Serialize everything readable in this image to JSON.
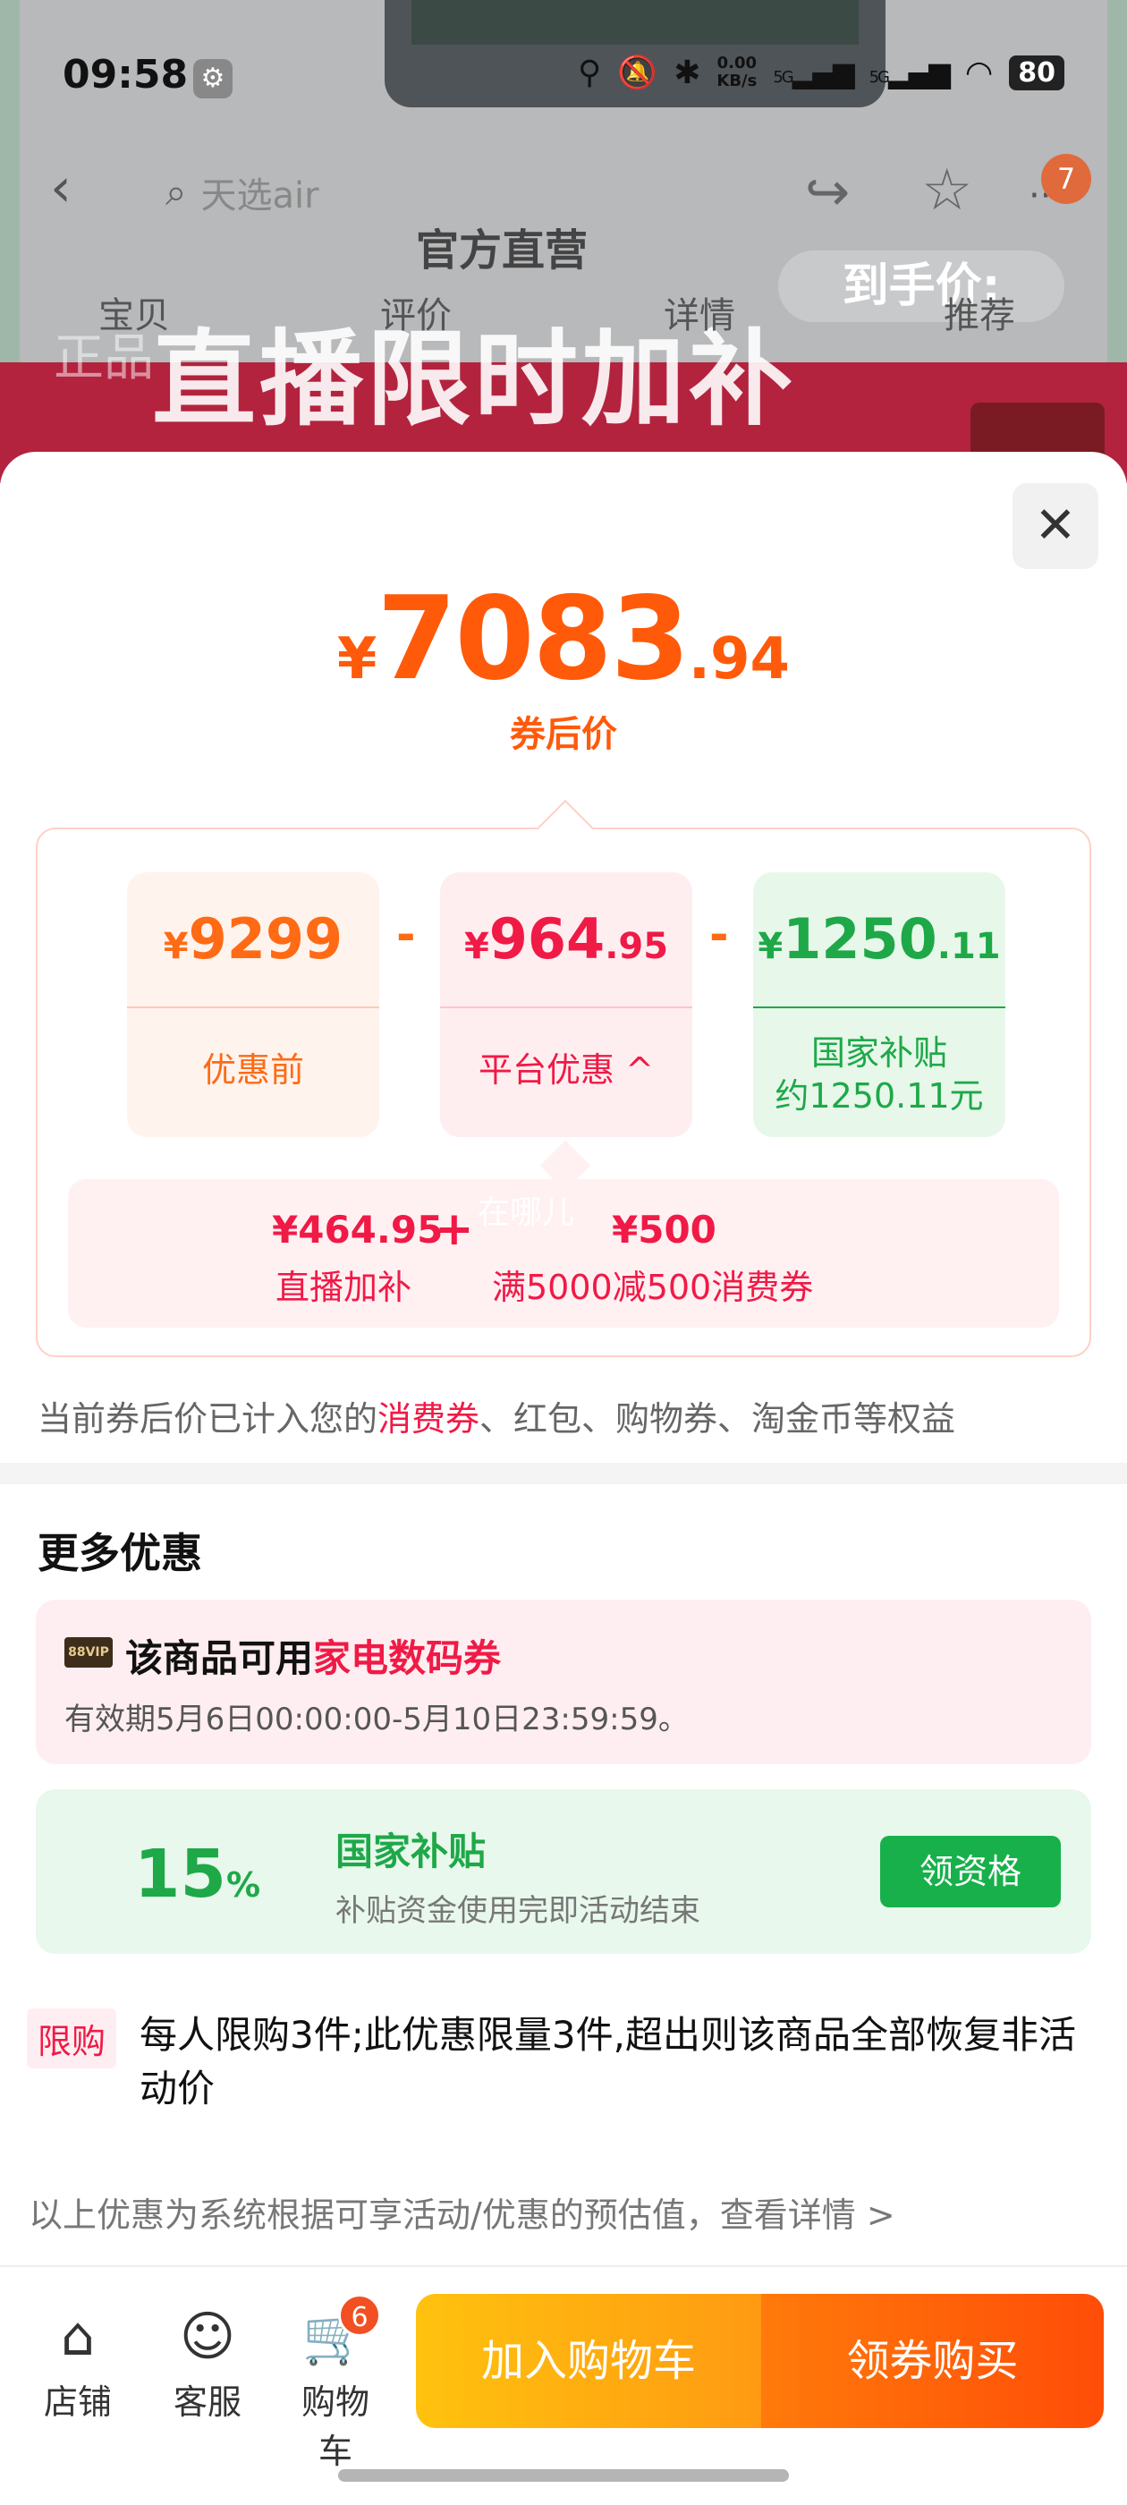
{
  "status": {
    "time": "09:58",
    "net_speed_value": "0.00",
    "net_speed_unit": "KB/s",
    "sig1": "5G",
    "sig2": "5G",
    "battery": "80"
  },
  "nav": {
    "search_placeholder": "天选air",
    "badge_count": "7"
  },
  "background": {
    "official_label": "官方直营",
    "banner_text": "直播限时加补",
    "banner_prefix": "正品",
    "final_price_label": "到手价:"
  },
  "tabs": [
    "宝贝",
    "评价",
    "详情",
    "推荐"
  ],
  "price": {
    "currency": "¥",
    "integer": "7083",
    "decimal": ".94",
    "label": "券后价"
  },
  "breakdown": {
    "before": {
      "currency": "¥",
      "integer": "9299",
      "decimal": "",
      "label": "优惠前"
    },
    "minus1": "-",
    "platform": {
      "currency": "¥",
      "integer": "964",
      "decimal": ".95",
      "label": "平台优惠",
      "arrow": "^"
    },
    "minus2": "-",
    "subsidy": {
      "currency": "¥",
      "integer": "1250",
      "decimal": ".11",
      "label_line1": "国家补贴",
      "label_line2": "约1250.11元"
    },
    "sub": {
      "amount1": "¥464.95",
      "desc1": "直播加补",
      "plus": "+",
      "where": "在哪儿",
      "amount2": "¥500",
      "desc2": "满5000减500消费券"
    }
  },
  "rights_note": {
    "pre": "当前券后价已计入您的",
    "hl": "消费券",
    "post": "、红包、购物券、淘金币等权益"
  },
  "more": {
    "title": "更多优惠",
    "coupon": {
      "vip_badge": "88VIP",
      "text_pre": "该商品可用",
      "text_hl": "家电数码券",
      "validity": "有效期5月6日00:00:00-5月10日23:59:59。"
    },
    "subsidy": {
      "percent": "15",
      "percent_sign": "%",
      "title": "国家补贴",
      "subtitle": "补贴资金使用完即活动结束",
      "button": "领资格"
    }
  },
  "limit": {
    "tag": "限购",
    "text": "每人限购3件;此优惠限量3件,超出则该商品全部恢复非活动价"
  },
  "disclaimer": "以上优惠为系统根据可享活动/优惠的预估值，查看详情 >",
  "bottom": {
    "shop": "店铺",
    "service": "客服",
    "cart": "购物车",
    "cart_badge": "6",
    "add_cart": "加入购物车",
    "buy": "领券购买"
  },
  "colors": {
    "accent_orange": "#ff5a0a",
    "accent_red": "#f01a46",
    "accent_green": "#1ea848"
  }
}
